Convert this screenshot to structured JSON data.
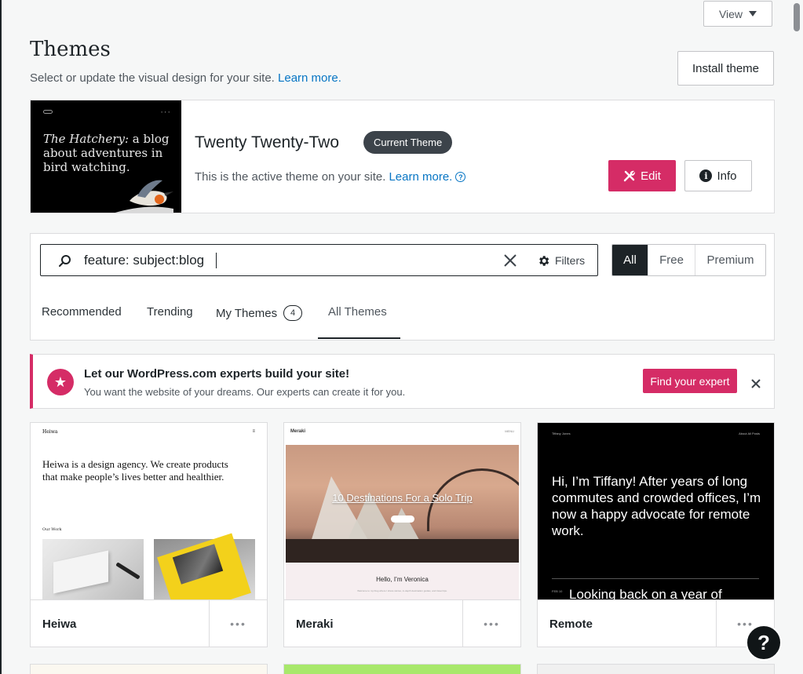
{
  "header": {
    "view_label": "View",
    "title": "Themes",
    "subtitle": "Select or update the visual design for your site.",
    "subtitle_link": "Learn more.",
    "install_label": "Install theme"
  },
  "current_theme": {
    "thumb_text_italic": "The Hatchery:",
    "thumb_text_rest": " a blog about adventures in bird watching.",
    "name": "Twenty Twenty-Two",
    "badge": "Current Theme",
    "description": "This is the active theme on your site.",
    "description_link": "Learn more.",
    "edit_label": "Edit",
    "info_label": "Info"
  },
  "search": {
    "value": "feature: subject:blog",
    "filters_label": "Filters",
    "segments": [
      "All",
      "Free",
      "Premium"
    ],
    "active_segment": "All"
  },
  "tabs": {
    "recommended": "Recommended",
    "trending": "Trending",
    "my_themes": "My Themes",
    "my_themes_count": "4",
    "all_themes": "All Themes",
    "active": "All Themes"
  },
  "banner": {
    "title": "Let our WordPress.com experts build your site!",
    "text": "You want the website of your dreams. Our experts can create it for you.",
    "button": "Find your expert"
  },
  "themes": [
    {
      "name": "Heiwa",
      "preview": {
        "logo": "Heiwa",
        "headline": "Heiwa is a design agency. We create products that make people’s lives better and healthier.",
        "section": "Our Work"
      }
    },
    {
      "name": "Meraki",
      "preview": {
        "logo": "Meraki",
        "nav": "MENU",
        "title": "10 Destinations For a Solo Trip",
        "hello": "Hello, I’m Veronica",
        "sub": "Welcome to my blog where I share stories, in-depth destination guides, and travel tips."
      }
    },
    {
      "name": "Remote",
      "preview": {
        "author": "Tiffany Jones",
        "nav": "About   All Posts",
        "headline": "Hi, I’m Tiffany! After years of long commutes and crowded offices, I’m now a happy advocate for remote work.",
        "post_date": "FEB 10",
        "post_title": "Looking back on a year of"
      }
    }
  ],
  "more_label": "•••",
  "help_label": "?",
  "colors": {
    "accent": "#d52c66",
    "link": "#0675c4",
    "dark": "#1d2327"
  }
}
